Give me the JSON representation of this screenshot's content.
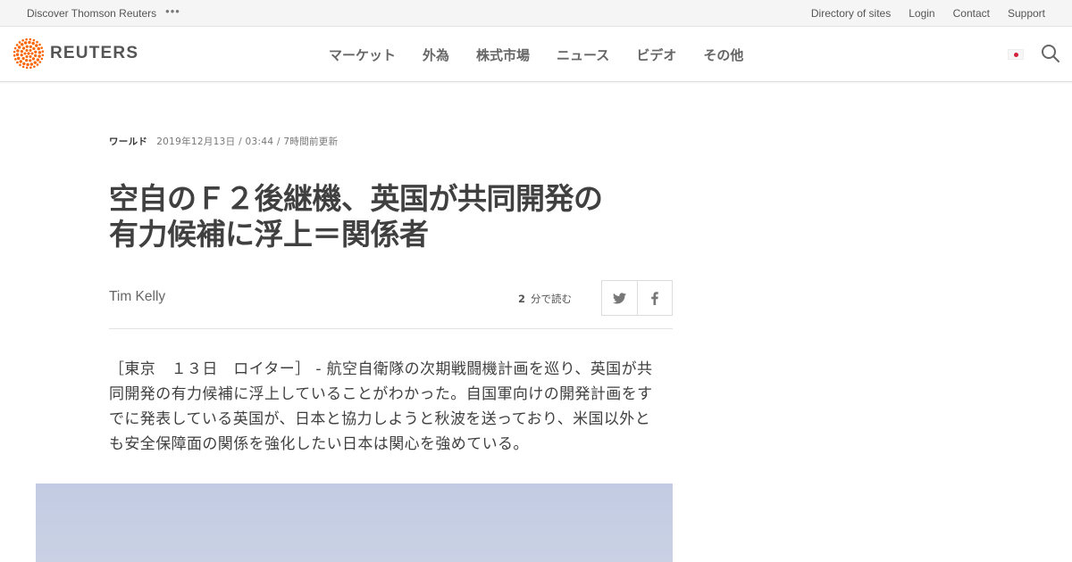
{
  "utility": {
    "discover": "Discover Thomson Reuters",
    "more": "•••",
    "links": [
      "Directory of sites",
      "Login",
      "Contact",
      "Support"
    ]
  },
  "header": {
    "logo_text": "REUTERS",
    "nav": [
      "マーケット",
      "外為",
      "株式市場",
      "ニュース",
      "ビデオ",
      "その他"
    ],
    "brand_color": "#fa6400",
    "flag_icon": "japan-flag-icon",
    "search_icon": "search-icon"
  },
  "article": {
    "section": "ワールド",
    "timestamp": "2019年12月13日 / 03:44 / 7時間前更新",
    "headline_line1": "空自のＦ２後継機、英国が共同開発の",
    "headline_line2": "有力候補に浮上＝関係者",
    "author": "Tim Kelly",
    "read_minutes": "2",
    "read_label": "分で読む",
    "share_icons": [
      "twitter-icon",
      "facebook-icon"
    ],
    "body_line1": "［東京　１３日　ロイター］ - 航空自衛隊の次期戦闘機計画を巡り、英国が共",
    "body_line2": "同開発の有力候補に浮上していることがわかった。自国軍向けの開発計画をす",
    "body_line3": "でに発表している英国が、日本と協力しようと秋波を送っており、米国以外と",
    "body_line4": "も安全保障面の関係を強化したい日本は関心を強めている。"
  }
}
